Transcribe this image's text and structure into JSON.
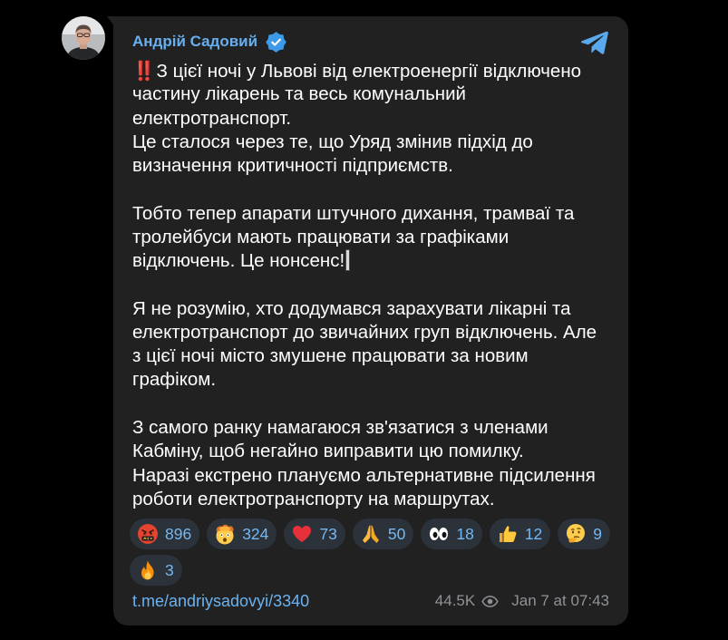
{
  "channel": {
    "name": "Андрій Садовий",
    "avatar_icon": "channel-avatar",
    "verified_icon": "verified-badge-icon",
    "logo_icon": "telegram-logo-icon"
  },
  "message": {
    "lead_emoji": "‼️",
    "paragraphs": [
      [
        "З цієї ночі у Львові від електроенергії відключено",
        "частину лікарень та весь комунальний",
        "електротранспорт.",
        "Це сталося через те, що Уряд змінив підхід до",
        "визначення критичності підприємств."
      ],
      [
        "Тобто тепер апарати штучного дихання, трамваї та",
        "тролейбуси мають працювати за графіками",
        "відключень. Це нонсенс!"
      ],
      [
        "Я не розумію, хто додумався зарахувати лікарні та",
        "електротранспорт до звичайних груп відключень. Але",
        "з цієї ночі місто змушене працювати за новим",
        "графіком."
      ],
      [
        "З самого ранку намагаюся зв'язатися з членами",
        "Кабміну, щоб негайно виправити цю помилку.",
        "Наразі екстрено плануємо альтернативне підсилення",
        "роботи електротранспорту на маршрутах."
      ]
    ]
  },
  "reactions": [
    {
      "icon": "face-with-symbols-icon",
      "count": "896"
    },
    {
      "icon": "exploding-head-icon",
      "count": "324"
    },
    {
      "icon": "red-heart-icon",
      "count": "73"
    },
    {
      "icon": "folded-hands-icon",
      "count": "50"
    },
    {
      "icon": "eyes-icon",
      "count": "18"
    },
    {
      "icon": "thumbs-up-icon",
      "count": "12"
    },
    {
      "icon": "thinking-face-icon",
      "count": "9"
    },
    {
      "icon": "fire-icon",
      "count": "3"
    }
  ],
  "footer": {
    "link": "t.me/andriysadovyi/3340",
    "views": "44.5K",
    "views_icon": "eye-icon",
    "date": "Jan 7 at 07:43"
  },
  "colors": {
    "background": "#000000",
    "bubble": "#212121",
    "accent": "#67aff0",
    "text": "#ffffff",
    "muted": "#8e9297",
    "reaction_bg": "#2b3239",
    "reaction_text": "#74b9f5",
    "link": "#6ab3f3"
  }
}
